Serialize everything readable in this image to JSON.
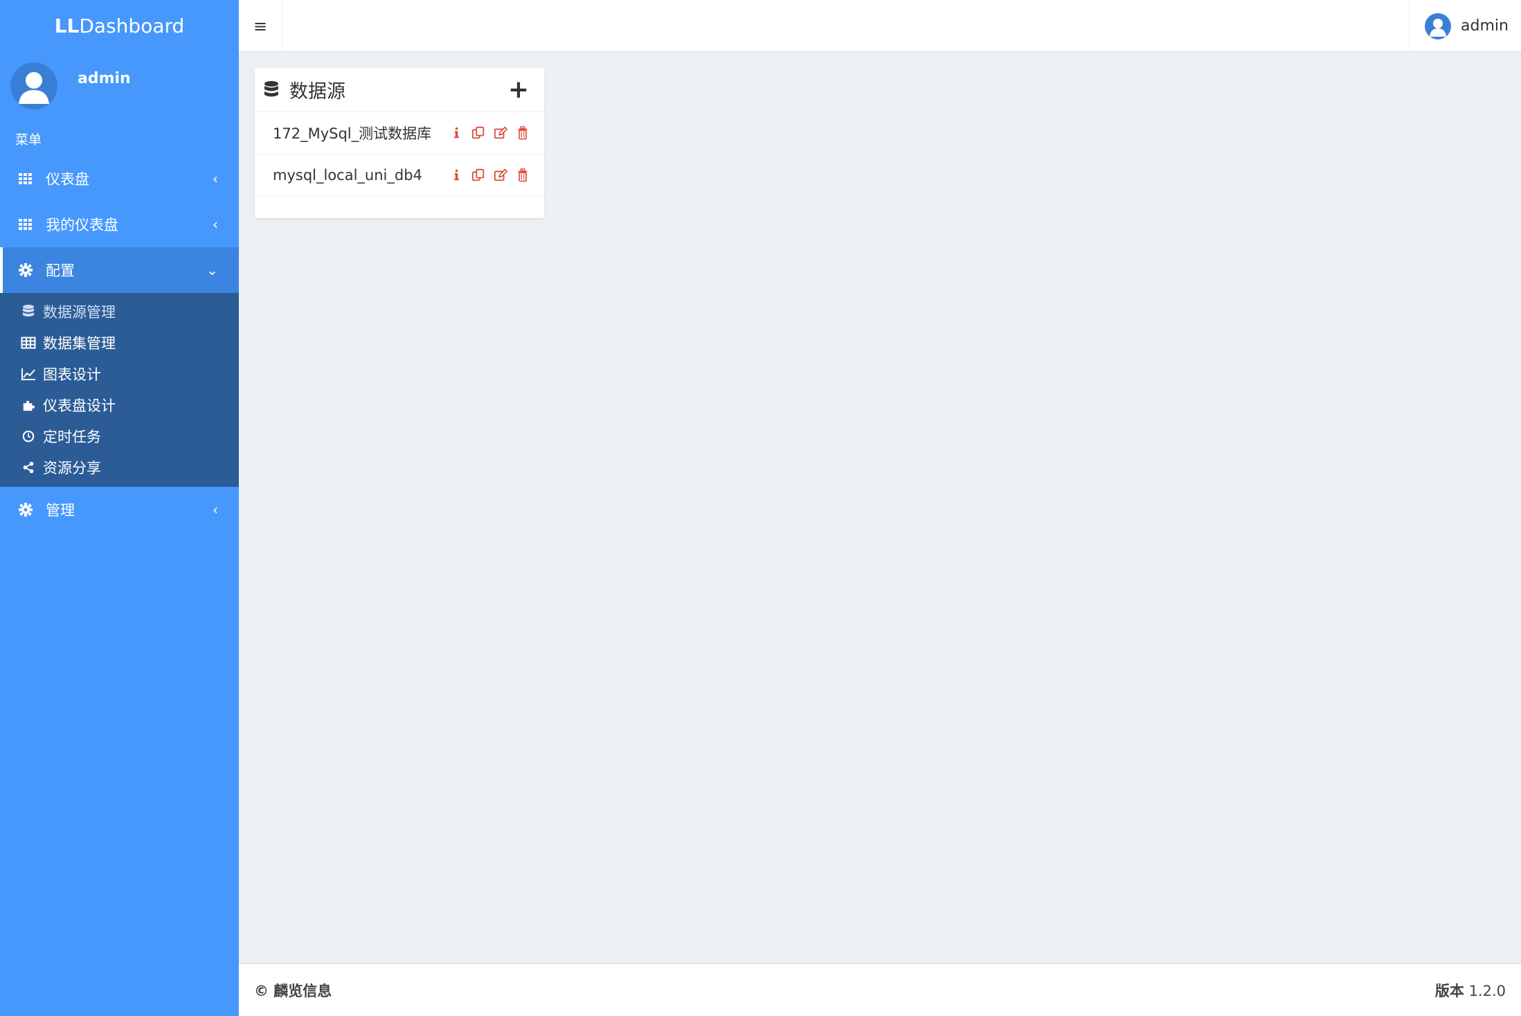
{
  "brand": {
    "bold": "LL",
    "rest": "Dashboard"
  },
  "sidebar": {
    "user_name": "admin",
    "menu_header": "菜单",
    "items": [
      {
        "label": "仪表盘",
        "icon": "grid-icon",
        "chevron": "‹"
      },
      {
        "label": "我的仪表盘",
        "icon": "grid-icon",
        "chevron": "‹"
      },
      {
        "label": "配置",
        "icon": "gear-icon",
        "chevron": "⌄"
      },
      {
        "label": "管理",
        "icon": "gear-icon",
        "chevron": "‹"
      }
    ],
    "submenu": [
      {
        "label": "数据源管理",
        "icon": "database-icon"
      },
      {
        "label": "数据集管理",
        "icon": "table-icon"
      },
      {
        "label": "图表设计",
        "icon": "line-chart-icon"
      },
      {
        "label": "仪表盘设计",
        "icon": "puzzle-icon"
      },
      {
        "label": "定时任务",
        "icon": "clock-icon"
      },
      {
        "label": "资源分享",
        "icon": "share-icon"
      }
    ]
  },
  "header": {
    "toggle": "≡",
    "user_name": "admin"
  },
  "datasource_box": {
    "title": "数据源",
    "add": "+",
    "rows": [
      {
        "name": "172_MySql_测试数据库"
      },
      {
        "name": "mysql_local_uni_db4"
      }
    ]
  },
  "footer": {
    "copyright": "© 麟览信息",
    "version_label": "版本",
    "version": "1.2.0"
  },
  "colors": {
    "sidebar": "#4698fd",
    "submenu": "#2b5c96",
    "action_red": "#dd4b39"
  }
}
